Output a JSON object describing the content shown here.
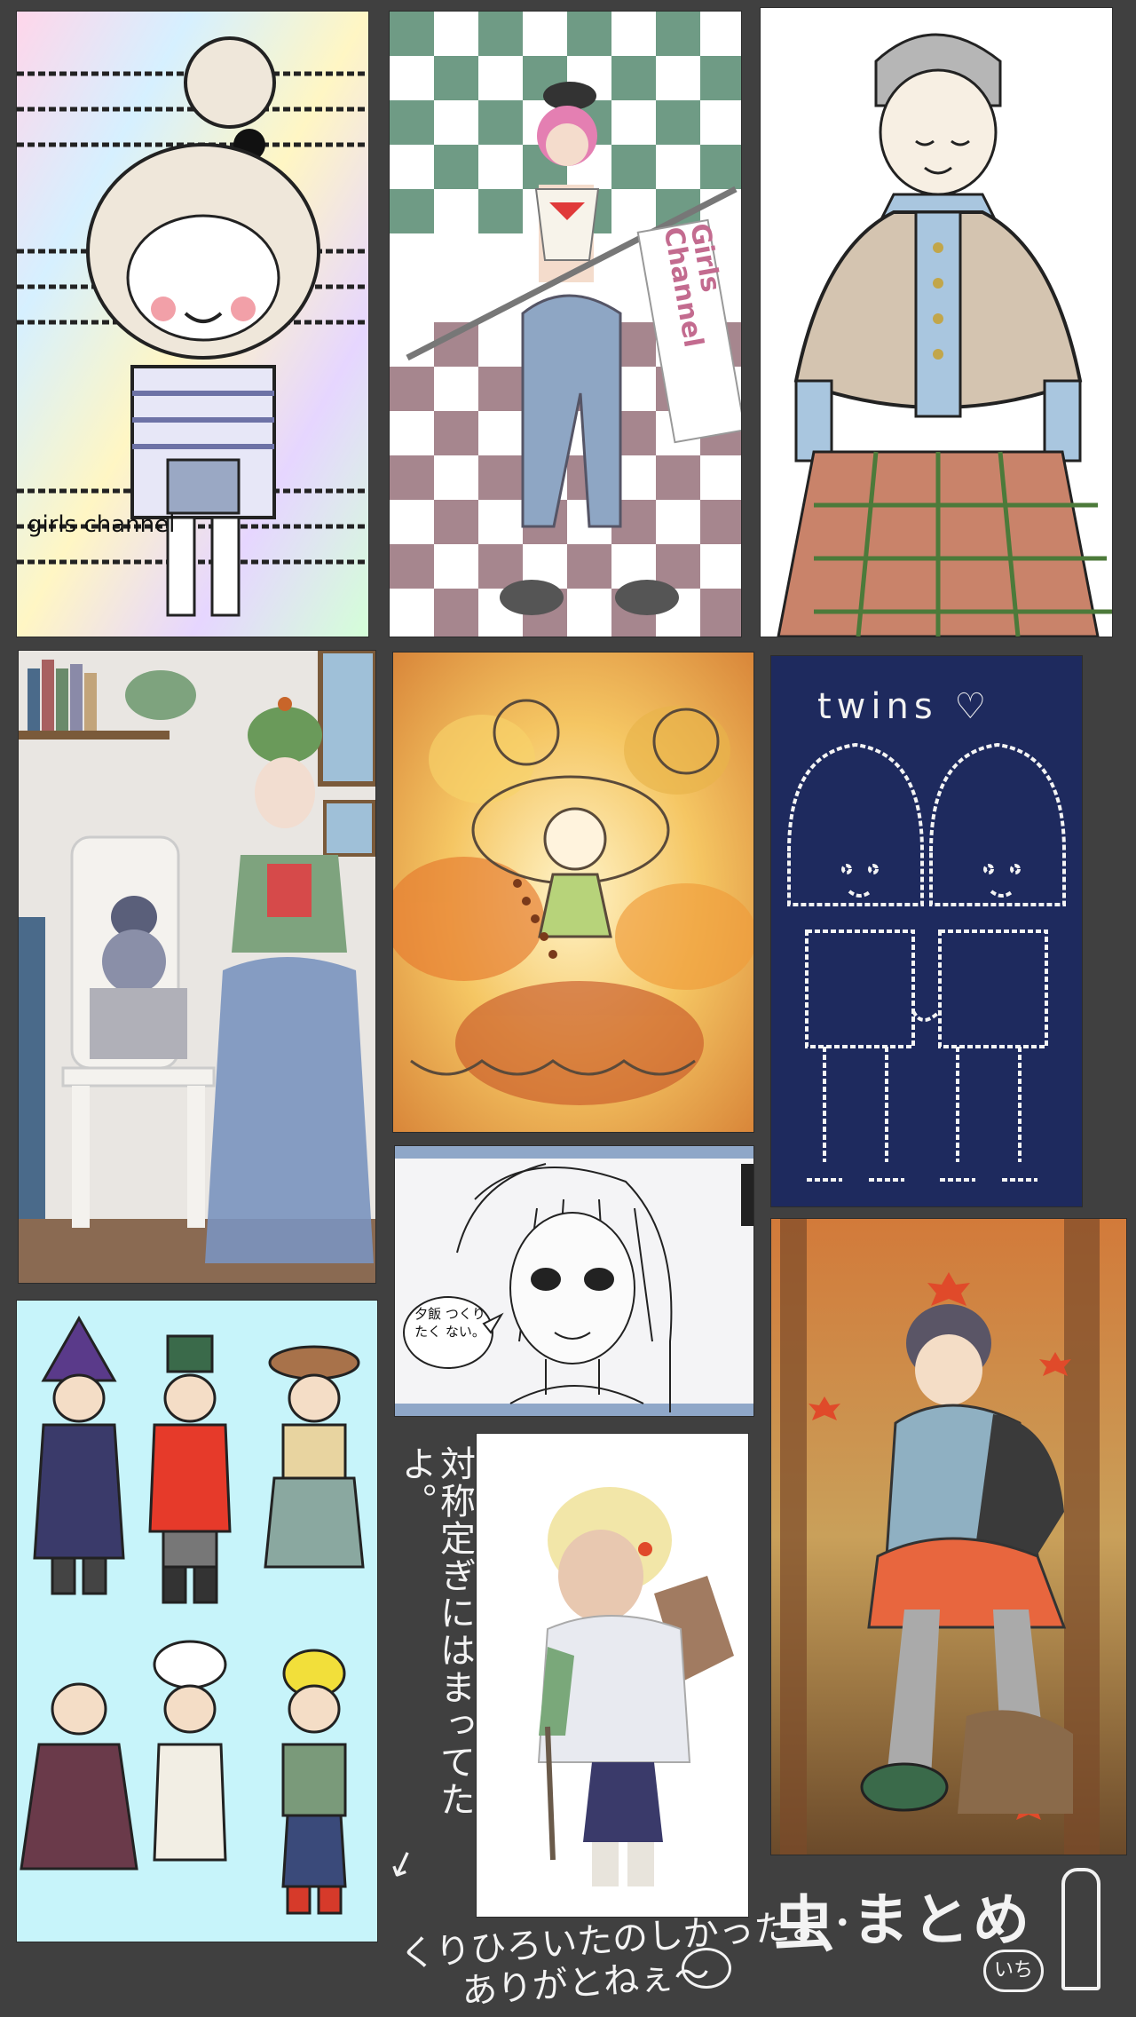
{
  "tiles": {
    "girls_channel_1": {
      "caption": "girls channel"
    },
    "girls_channel_2": {
      "flag_text": "Girls Channel"
    },
    "twins": {
      "title": "twins ♡"
    },
    "manga": {
      "bubble": "夕飯 つくりたく ない。"
    }
  },
  "notes": {
    "side": "対称定ぎにはまってたよ。",
    "bottom_line1": "くりひろいたのしかったよ・",
    "bottom_line2": "ありがとねぇ〜",
    "title": "まとめ",
    "title_badge": "いち"
  },
  "colors": {
    "background": "#404040",
    "ink": "#1a1a1a",
    "twins_bg": "#1e2a5e",
    "chibi_bg": "#c7f4fa"
  }
}
